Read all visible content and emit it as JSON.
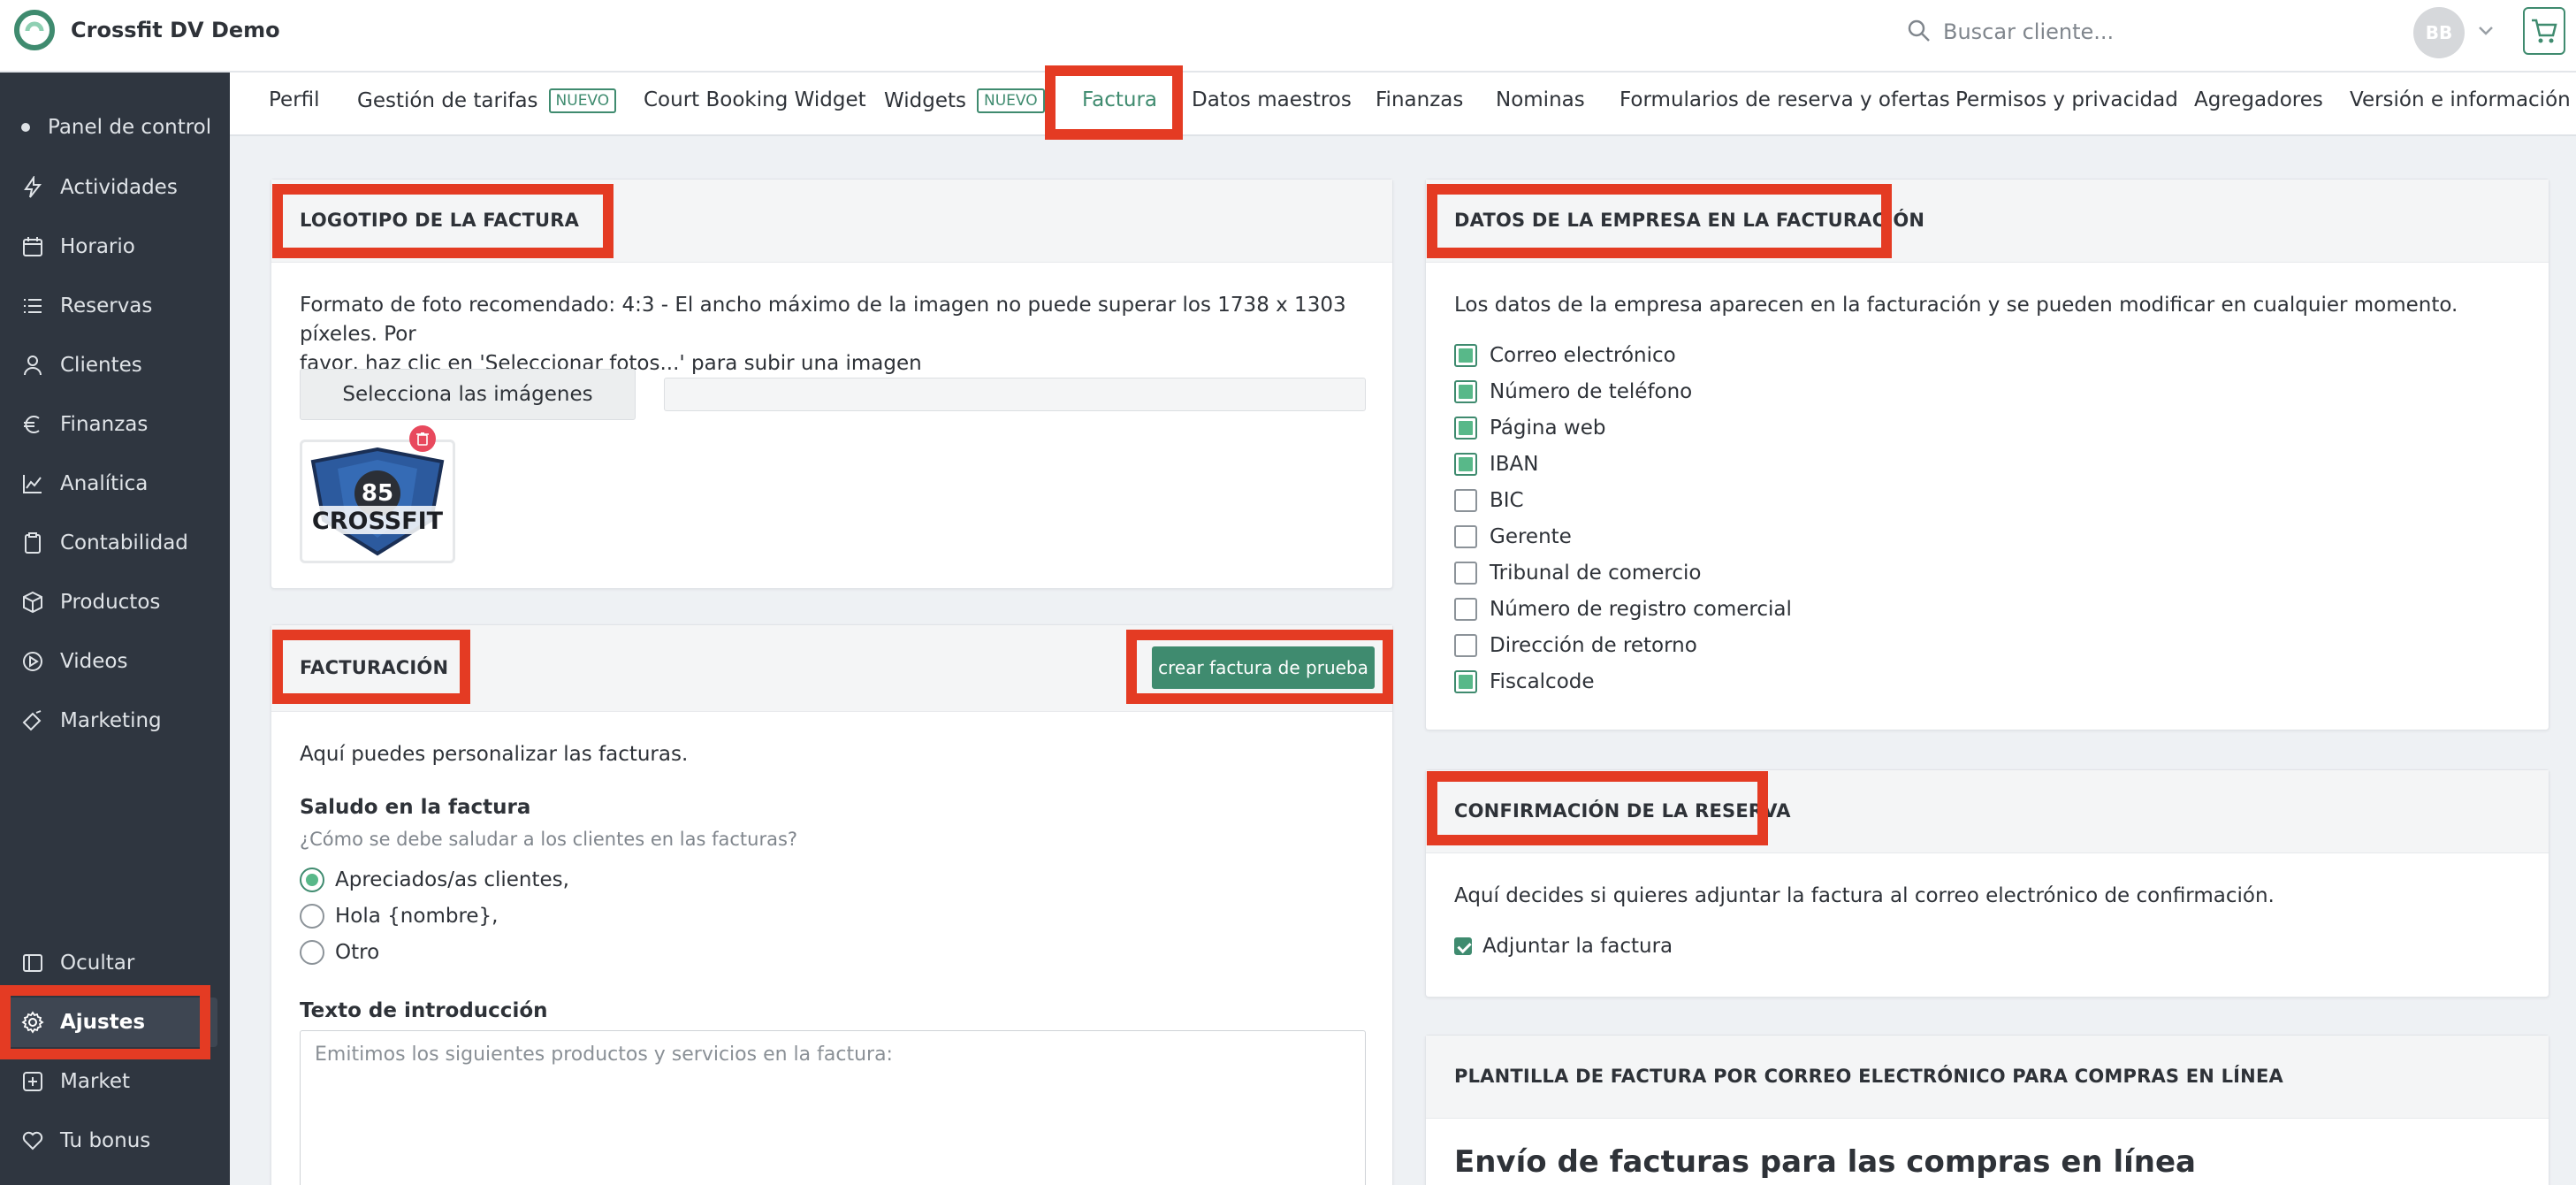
{
  "app": {
    "title": "Crossfit DV Demo",
    "avatar_initials": "BB"
  },
  "search": {
    "placeholder": "Buscar cliente..."
  },
  "colors": {
    "accent": "#3f8b6f",
    "sidebar": "#2f3640",
    "highlight": "#e43b23"
  },
  "sidebar": {
    "items": [
      {
        "label": "Panel de control",
        "icon": "dot-icon"
      },
      {
        "label": "Actividades",
        "icon": "lightning-icon"
      },
      {
        "label": "Horario",
        "icon": "calendar-icon"
      },
      {
        "label": "Reservas",
        "icon": "list-icon"
      },
      {
        "label": "Clientes",
        "icon": "user-icon"
      },
      {
        "label": "Finanzas",
        "icon": "euro-icon"
      },
      {
        "label": "Analítica",
        "icon": "chart-icon"
      },
      {
        "label": "Contabilidad",
        "icon": "clipboard-icon"
      },
      {
        "label": "Productos",
        "icon": "box-icon"
      },
      {
        "label": "Videos",
        "icon": "play-icon"
      },
      {
        "label": "Marketing",
        "icon": "megaphone-icon"
      }
    ],
    "bottom": [
      {
        "label": "Ocultar",
        "icon": "collapse-icon"
      },
      {
        "label": "Ajustes",
        "icon": "gear-icon",
        "active": true
      },
      {
        "label": "Market",
        "icon": "plus-square-icon"
      },
      {
        "label": "Tu bonus",
        "icon": "heart-icon"
      }
    ]
  },
  "tabs": {
    "perfil": "Perfil",
    "tarifas": "Gestión de tarifas",
    "tarifas_badge": "NUEVO",
    "court": "Court Booking Widget",
    "widgets": "Widgets",
    "widgets_badge": "NUEVO",
    "factura": "Factura",
    "datos": "Datos maestros",
    "finanzas": "Finanzas",
    "nominas": "Nominas",
    "formularios": "Formularios de reserva y ofertas",
    "permisos": "Permisos y privacidad",
    "agregadores": "Agregadores",
    "version": "Versión e información"
  },
  "logo_card": {
    "title": "LOGOTIPO DE LA FACTURA",
    "desc_line1": "Formato de foto recomendado: 4:3 - El ancho máximo de la imagen no puede superar los 1738 x 1303 píxeles. Por",
    "desc_line2": "favor, haz clic en 'Seleccionar fotos...' para subir una imagen",
    "select_button": "Selecciona las imágenes",
    "logo_text_top": "85",
    "logo_text": "CROSSFIT"
  },
  "billing_card": {
    "title": "FACTURACIÓN",
    "test_button": "crear factura de prueba",
    "intro": "Aquí puedes personalizar las facturas.",
    "greeting_label": "Saludo en la factura",
    "greeting_help": "¿Cómo se debe saludar a los clientes en las facturas?",
    "greeting_options": [
      "Apreciados/as clientes,",
      "Hola {nombre},",
      "Otro"
    ],
    "greeting_selected": 0,
    "intro_text_label": "Texto de introducción",
    "intro_text_placeholder": "Emitimos los siguientes productos y servicios en la factura:"
  },
  "company_card": {
    "title": "DATOS DE LA EMPRESA EN LA FACTURACIÓN",
    "desc": "Los datos de la empresa aparecen en la facturación y se pueden modificar en cualquier momento.",
    "fields": [
      {
        "label": "Correo electrónico",
        "checked": true
      },
      {
        "label": "Número de teléfono",
        "checked": true
      },
      {
        "label": "Página web",
        "checked": true
      },
      {
        "label": "IBAN",
        "checked": true
      },
      {
        "label": "BIC",
        "checked": false
      },
      {
        "label": "Gerente",
        "checked": false
      },
      {
        "label": "Tribunal de comercio",
        "checked": false
      },
      {
        "label": "Número de registro comercial",
        "checked": false
      },
      {
        "label": "Dirección de retorno",
        "checked": false
      },
      {
        "label": "Fiscalcode",
        "checked": true
      }
    ]
  },
  "booking_card": {
    "title": "CONFIRMACIÓN DE LA RESERVA",
    "desc": "Aquí decides si quieres adjuntar la factura al correo electrónico de confirmación.",
    "attach_label": "Adjuntar la factura",
    "attach_checked": true
  },
  "email_card": {
    "title": "PLANTILLA DE FACTURA POR CORREO ELECTRÓNICO PARA COMPRAS EN LÍNEA",
    "heading": "Envío de facturas para las compras en línea"
  }
}
